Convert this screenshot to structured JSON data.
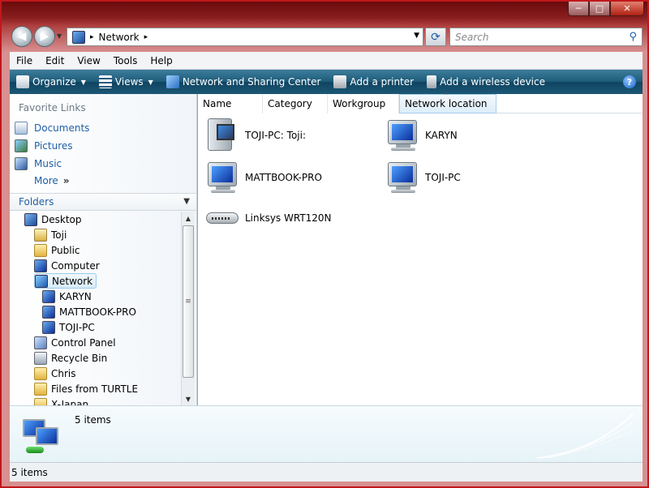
{
  "window": {
    "minimize": "─",
    "maximize": "□",
    "close": "✕"
  },
  "address": {
    "root_sep": "▸",
    "location": "Network",
    "end_sep": "▸"
  },
  "search": {
    "placeholder": "Search"
  },
  "menu": [
    "File",
    "Edit",
    "View",
    "Tools",
    "Help"
  ],
  "toolbar": {
    "organize": "Organize",
    "views": "Views",
    "network_center": "Network and Sharing Center",
    "add_printer": "Add a printer",
    "add_wireless": "Add a wireless device",
    "help": "?"
  },
  "favorites": {
    "title": "Favorite Links",
    "items": [
      "Documents",
      "Pictures",
      "Music"
    ],
    "more": "More",
    "more_arrow": "»"
  },
  "folders": {
    "title": "Folders",
    "tree": [
      {
        "label": "Desktop",
        "icon": "desktop-icon"
      },
      {
        "label": "Toji",
        "icon": "user-folder-icon"
      },
      {
        "label": "Public",
        "icon": "folder-icon"
      },
      {
        "label": "Computer",
        "icon": "computer-icon"
      },
      {
        "label": "Network",
        "icon": "network-icon",
        "selected": true
      },
      {
        "label": "KARYN",
        "icon": "computer-icon"
      },
      {
        "label": "MATTBOOK-PRO",
        "icon": "computer-icon"
      },
      {
        "label": "TOJI-PC",
        "icon": "computer-icon"
      },
      {
        "label": "Control Panel",
        "icon": "control-panel-icon"
      },
      {
        "label": "Recycle Bin",
        "icon": "recycle-bin-icon"
      },
      {
        "label": "Chris",
        "icon": "folder-icon"
      },
      {
        "label": "Files from TURTLE",
        "icon": "folder-icon"
      },
      {
        "label": "X-Japan",
        "icon": "folder-icon"
      }
    ]
  },
  "columns": [
    "Name",
    "Category",
    "Workgroup",
    "Network location"
  ],
  "sort_indicator": "^",
  "items": [
    {
      "label": "TOJI-PC: Toji:",
      "kind": "media-device"
    },
    {
      "label": "KARYN",
      "kind": "computer"
    },
    {
      "label": "MATTBOOK-PRO",
      "kind": "computer"
    },
    {
      "label": "TOJI-PC",
      "kind": "computer"
    },
    {
      "label": "Linksys WRT120N",
      "kind": "router"
    }
  ],
  "details": {
    "count": "5 items"
  },
  "status": {
    "text": "5 items"
  },
  "colors": {
    "toolbar": "#1d5a78",
    "link": "#1f5fa6",
    "selection": "#d8ecf9",
    "frame": "#c0181c"
  }
}
